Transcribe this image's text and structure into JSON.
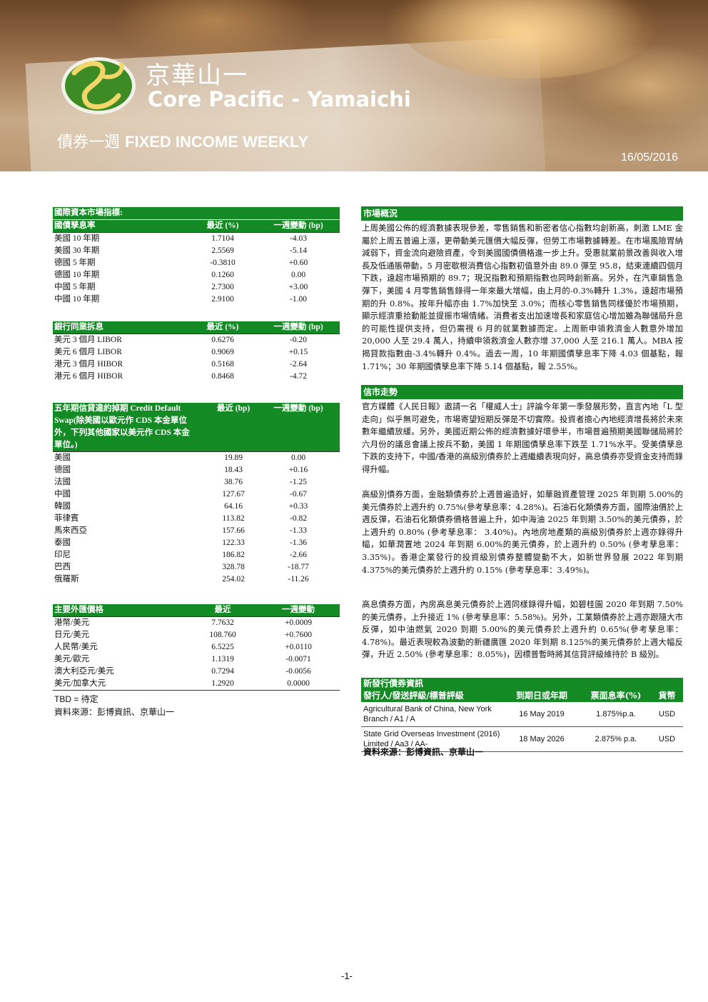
{
  "header": {
    "brand_cn": "京華山一",
    "brand_en": "Core Pacific - Yamaichi",
    "report_title_cn": "債券一週",
    "report_title_en": "FIXED INCOME WEEKLY",
    "date": "16/05/2016"
  },
  "gov_bonds": {
    "section_title": "國際資本市場指標:",
    "col1": "國債孳息率",
    "col2": "最近 (%)",
    "col3": "一週變動 (bp)",
    "rows": [
      {
        "name": "美國 10 年期",
        "latest": "1.7104",
        "change": "-4.03"
      },
      {
        "name": "美國 30 年期",
        "latest": "2.5569",
        "change": "-5.14"
      },
      {
        "name": "德國 5 年期",
        "latest": "-0.3810",
        "change": "+0.60"
      },
      {
        "name": "德國 10 年期",
        "latest": "0.1260",
        "change": "0.00"
      },
      {
        "name": "中國 5 年期",
        "latest": "2.7300",
        "change": "+3.00"
      },
      {
        "name": "中國 10 年期",
        "latest": "2.9100",
        "change": "-1.00"
      }
    ]
  },
  "interbank": {
    "col1": "銀行同業拆息",
    "col2": "最近 (%)",
    "col3": "一週變動 (bp)",
    "rows": [
      {
        "name": "美元 3 個月 LIBOR",
        "latest": "0.6276",
        "change": "-0.20"
      },
      {
        "name": "美元 6 個月 LIBOR",
        "latest": "0.9069",
        "change": "+0.15"
      },
      {
        "name": "港元 3 個月 HIBOR",
        "latest": "0.5168",
        "change": "-2.64"
      },
      {
        "name": "港元 6 個月 HIBOR",
        "latest": "0.8468",
        "change": "-4.72"
      }
    ]
  },
  "cds": {
    "col1_line1": "五年期信貸違約掉期 Credit Default",
    "col1_line2": "Swap(除美國以歐元作 CDS 本金單位",
    "col1_line3": "外，下列其他國家以美元作 CDS 本金",
    "col1_line4": "單位。)",
    "col2": "最近 (bp)",
    "col3": "一週變動 (bp)",
    "rows": [
      {
        "name": "美國",
        "latest": "19.89",
        "change": "0.00"
      },
      {
        "name": "德國",
        "latest": "18.43",
        "change": "+0.16"
      },
      {
        "name": "法國",
        "latest": "38.76",
        "change": "-1.25"
      },
      {
        "name": "中國",
        "latest": "127.67",
        "change": "-0.67"
      },
      {
        "name": "韓國",
        "latest": "64.16",
        "change": "+0.33"
      },
      {
        "name": "菲律賓",
        "latest": "113.82",
        "change": "-0.82"
      },
      {
        "name": "馬來西亞",
        "latest": "157.66",
        "change": "-1.33"
      },
      {
        "name": "泰國",
        "latest": "122.33",
        "change": "-1.36"
      },
      {
        "name": "印尼",
        "latest": "186.82",
        "change": "-2.66"
      },
      {
        "name": "巴西",
        "latest": "328.78",
        "change": "-18.77"
      },
      {
        "name": "俄羅斯",
        "latest": "254.02",
        "change": "-11.26"
      }
    ]
  },
  "fx": {
    "col1": "主要外匯價格",
    "col2": "最近",
    "col3": "一週變動",
    "rows": [
      {
        "name": "港幣/美元",
        "latest": "7.7632",
        "change": "+0.0009"
      },
      {
        "name": "日元/美元",
        "latest": "108.760",
        "change": "+0.7600"
      },
      {
        "name": "人民幣/美元",
        "latest": "6.5225",
        "change": "+0.0110"
      },
      {
        "name": "美元/歐元",
        "latest": "1.1319",
        "change": "-0.0071"
      },
      {
        "name": "澳大利亞元/美元",
        "latest": "0.7294",
        "change": "-0.0056"
      },
      {
        "name": "美元/加拿大元",
        "latest": "1.2920",
        "change": "0.0000"
      }
    ],
    "tbd_note": "TBD = 待定",
    "source": "資料來源：彭博資訊、京華山一"
  },
  "market": {
    "heading": "市場概況",
    "body": "上周美國公佈的經濟數據表現參差，零售銷售和新密者信心指數均創新高，刺激 LME 金屬於上周五普遍上漲，更帶動美元匯價大幅反彈，但勞工市場數據轉差。在市場風險胃納減弱下，資金流向避險資產，令到美國國債價格進一步上升。受惠就業前景改善與收入增長及低通脹帶動，5 月密歇根消費信心指數初值意外由 89.0 彈至 95.8，結束連續四個月下跌，遠超市場預期的 89.7；現況指數和預期指數也同時創新高。另外，在汽車銷售急彈下，美國 4 月零售銷售錄得一年來最大增幅，由上月的-0.3%轉升 1.3%，遠超市場預期的升 0.8%。按年升幅亦由 1.7%加快至 3.0%；而核心零售銷售同樣優於市場預期，顯示經濟重拾動能並提振市場情緒。消費者支出加速增長和家庭信心增加雖為聯儲局升息的可能性提供支持，但仍需視 6 月的就業數據而定。上周新申領救濟金人數意外增加 20,000 人至 29.4 萬人，持續申領救濟金人數亦增 37,000 人至 216.1 萬人。MBA 按揭貸款指數由-3.4%轉升 0.4%。過去一周，10 年期國債孳息率下降 4.03 個基點，報 1.71%；30 年期國債孳息率下降 5.14 個基點，報 2.55%。"
  },
  "credit": {
    "heading": "信市走勢",
    "p1": "官方媒體《人民日報》邀請一名「權威人士」評論今年第一季發展形勢，直言內地「L 型走向」似乎無可避免，市場寄望短期反彈是不切實際。投資者擔心內地經濟增長將於未來數年繼續放緩。另外，美國近期公佈的經濟數據好壞參半，市場普遍預期美國聯儲局將於六月份的議息會議上按兵不動，美國 1 年期國債孳息率下跌至 1.71%水平。受美債孳息下跌的支持下，中國/香港的高級別債券於上週繼續表現向好，高息債券亦受資金支持而錄得升幅。",
    "p2": "高級別債券方面，金融類債券於上週普遍造好，如華融資產管理 2025 年到期 5.00%的美元債券於上週升約 0.75%(參考孳息率：4.28%)。石油石化類債券方面，國際油價於上週反彈，石油石化類債券價格普遍上升，如中海油 2025 年到期 3.50%的美元債券，於上週升約 0.80% (參考孳息率： 3.40%)。內地房地產類的高級別債券於上週亦錄得升幅，如華潤置地 2024 年到期 6.00%的美元債券，於上週升約 0.50% (參考孳息率：3.35%)。香港企業發行的投資級別債券整體變動不大，如新世界發展 2022 年到期 4.375%的美元債券於上週升約 0.15% (參考孳息率：3.49%)。",
    "p3": "高息債券方面，內房高息美元債券於上週同樣錄得升幅，如碧桂園 2020 年到期 7.50%的美元債券，上升接近 1% (參考孳息率：5.58%)。另外，工業類債券於上週亦跟隨大市反彈，如中油燃氣 2020 到期 5.00%的美元債券於上週升約 0.65%(參考孳息率：4.78%)。最近表現較為波動的新疆廣匯 2020 年到期 8.125%的美元債券於上週大幅反彈，升近 2.50% (參考孳息率：8.05%)，因標普暫時將其信貸評級維持於 B 級別。"
  },
  "new_issues": {
    "heading": "新發行債券資訊",
    "col1": "發行人/發送評級/標普評級",
    "col2": "到期日或年期",
    "col3": "票面息率(%)",
    "col4": "貨幣",
    "rows": [
      {
        "issuer": "Agricultural Bank of China, New York Branch / A1 / A",
        "maturity": "16 May 2019",
        "coupon": "1.875%p.a.",
        "currency": "USD"
      },
      {
        "issuer": "State Grid Overseas Investment (2016) Limited / Aa3 / AA-",
        "maturity": "18 May 2026",
        "coupon": "2.875% p.a.",
        "currency": "USD"
      }
    ],
    "source": "資料來源：彭博資訊、京華山一"
  },
  "footer": {
    "page": "-1-"
  },
  "colors": {
    "accent_green": "#138a24"
  }
}
